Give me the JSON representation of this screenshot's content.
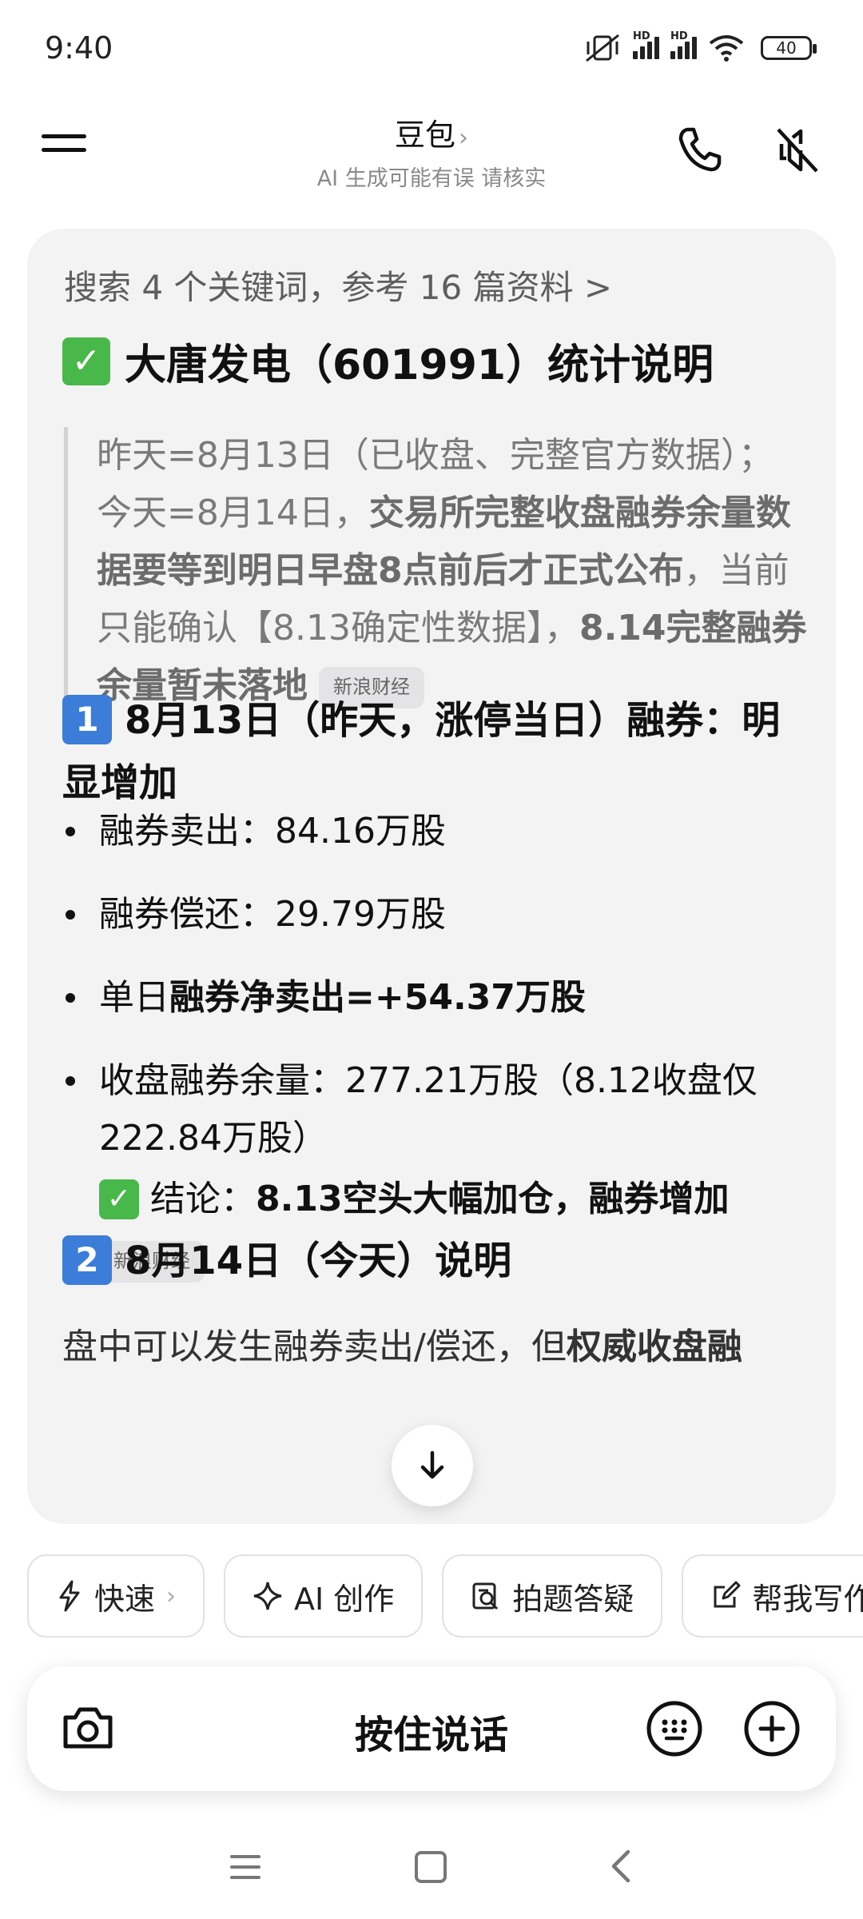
{
  "status_bar": {
    "time": "9:40",
    "battery": "40",
    "hd": "HD"
  },
  "header": {
    "title": "豆包",
    "subtitle": "AI 生成可能有误 请核实"
  },
  "message": {
    "search_summary": "搜索 4 个关键词，参考 16 篇资料 >",
    "heading": "大唐发电（601991）统计说明",
    "quote": {
      "part1": "昨天=8月13日（已收盘、完整官方数据）；今天=8月14日，",
      "part2_bold": "交易所完整收盘融券余量数据要等到明日早盘8点前后才正式公布",
      "part3": "，当前只能确认【8.13确定性数据】，",
      "part4_bold": "8.14完整融券余量暂未落地",
      "source_tag": "新浪财经"
    },
    "section1": {
      "badge": "1",
      "title": "8月13日（昨天，涨停当日）融券：明显增加"
    },
    "bullets": [
      {
        "text": "融券卖出：84.16万股"
      },
      {
        "text": "融券偿还：29.79万股"
      },
      {
        "prefix": "单日",
        "bold": "融券净卖出=+54.37万股"
      },
      {
        "text": "收盘融券余量：277.21万股（8.12收盘仅222.84万股）"
      }
    ],
    "conclusion": {
      "label": "结论：",
      "bold": "8.13空头大幅加仓，融券增加",
      "source_tag": "新浪财经"
    },
    "section2": {
      "badge": "2",
      "title": "8月14日（今天）说明"
    },
    "partial_line": {
      "text": "盘中可以发生融券卖出/偿还，但",
      "bold": "权威收盘融"
    }
  },
  "quick_actions": [
    {
      "label": "快速",
      "icon": "bolt-icon",
      "chevron": "›"
    },
    {
      "label": "AI 创作",
      "icon": "sparkle-icon"
    },
    {
      "label": "拍题答疑",
      "icon": "photo-search-icon"
    },
    {
      "label": "帮我写作",
      "icon": "edit-icon"
    }
  ],
  "input_bar": {
    "speak_label": "按住说话"
  },
  "colors": {
    "accent_green": "#49b84a",
    "badge_blue": "#3b7dd8",
    "card_bg": "#f3f3f4"
  }
}
